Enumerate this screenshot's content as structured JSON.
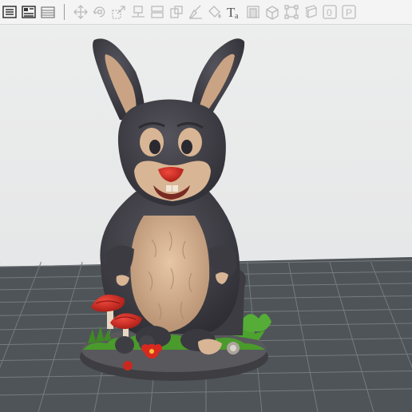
{
  "toolbar": {
    "buttons": [
      {
        "name": "object-list-icon",
        "enabled": true
      },
      {
        "name": "layout-icon",
        "enabled": true
      },
      {
        "name": "layers-list-icon",
        "enabled": true
      },
      {
        "name": "move-icon",
        "enabled": false
      },
      {
        "name": "rotate-icon",
        "enabled": false
      },
      {
        "name": "scale-icon",
        "enabled": false
      },
      {
        "name": "place-on-face-icon",
        "enabled": false
      },
      {
        "name": "cut-icon",
        "enabled": false
      },
      {
        "name": "split-icon",
        "enabled": false
      },
      {
        "name": "support-paint-icon",
        "enabled": false
      },
      {
        "name": "color-paint-icon",
        "enabled": false
      },
      {
        "name": "text-icon",
        "enabled": true,
        "glyph": "T",
        "subscript": "a"
      },
      {
        "name": "arrange-icon",
        "enabled": false
      },
      {
        "name": "cube-icon",
        "enabled": false
      },
      {
        "name": "bounding-box-icon",
        "enabled": false
      },
      {
        "name": "slice-layers-icon",
        "enabled": false
      },
      {
        "name": "plate-number-icon",
        "enabled": false,
        "glyph": "0"
      },
      {
        "name": "plate-p-icon",
        "enabled": false,
        "glyph": "P"
      }
    ]
  },
  "scene": {
    "model": "rabbit-figurine",
    "colors": {
      "fur_dark": "#403f47",
      "fur_light": "#d8b594",
      "nose": "#d9291f",
      "grass": "#4a9a2c",
      "base": "#4e4e52",
      "mushroom": "#c8281f",
      "plate": "#505559",
      "plate_grid": "#7b8085",
      "background": "#e6e7e8"
    }
  }
}
